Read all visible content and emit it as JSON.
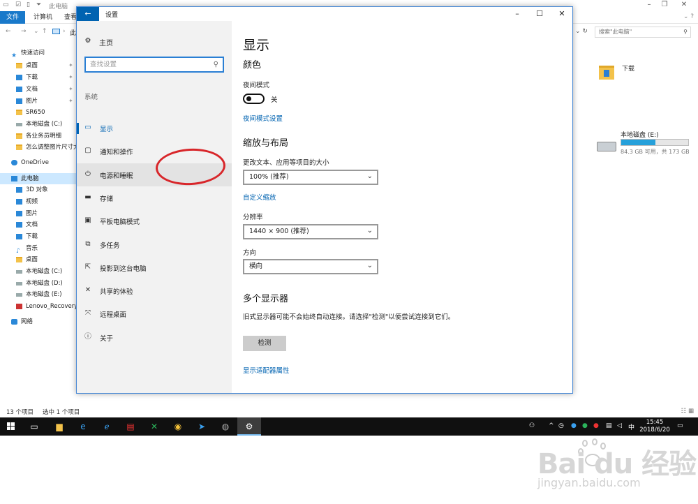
{
  "explorer": {
    "title": "此电脑",
    "tabs": [
      "文件",
      "计算机",
      "查看"
    ],
    "breadcrumb": "此",
    "search_placeholder": "搜索\"此电脑\"",
    "nav": [
      {
        "label": "快速访问",
        "icon": "star-icon",
        "pinned": false,
        "selected": false
      },
      {
        "label": "桌面",
        "icon": "folder-icon",
        "pinned": true,
        "selected": false
      },
      {
        "label": "下载",
        "icon": "download-icon",
        "pinned": true,
        "selected": false
      },
      {
        "label": "文档",
        "icon": "document-icon",
        "pinned": true,
        "selected": false
      },
      {
        "label": "图片",
        "icon": "picture-icon",
        "pinned": true,
        "selected": false
      },
      {
        "label": "SR650",
        "icon": "folder-icon",
        "pinned": false,
        "selected": false
      },
      {
        "label": "本地磁盘 (C:)",
        "icon": "drive-icon",
        "pinned": false,
        "selected": false
      },
      {
        "label": "各业务员明细",
        "icon": "folder-icon",
        "pinned": false,
        "selected": false
      },
      {
        "label": "怎么调整图片尺寸大",
        "icon": "folder-icon",
        "pinned": false,
        "selected": false
      },
      {
        "label": "OneDrive",
        "icon": "cloud-icon",
        "pinned": false,
        "selected": false
      },
      {
        "label": "此电脑",
        "icon": "computer-icon",
        "pinned": false,
        "selected": true
      },
      {
        "label": "3D 对象",
        "icon": "cube-icon",
        "pinned": false,
        "selected": false
      },
      {
        "label": "视频",
        "icon": "video-icon",
        "pinned": false,
        "selected": false
      },
      {
        "label": "图片",
        "icon": "picture-icon",
        "pinned": false,
        "selected": false
      },
      {
        "label": "文档",
        "icon": "document-icon",
        "pinned": false,
        "selected": false
      },
      {
        "label": "下载",
        "icon": "download-icon",
        "pinned": false,
        "selected": false
      },
      {
        "label": "音乐",
        "icon": "music-icon",
        "pinned": false,
        "selected": false
      },
      {
        "label": "桌面",
        "icon": "folder-icon",
        "pinned": false,
        "selected": false
      },
      {
        "label": "本地磁盘 (C:)",
        "icon": "drive-icon",
        "pinned": false,
        "selected": false
      },
      {
        "label": "本地磁盘 (D:)",
        "icon": "drive-icon",
        "pinned": false,
        "selected": false
      },
      {
        "label": "本地磁盘 (E:)",
        "icon": "drive-icon",
        "pinned": false,
        "selected": false
      },
      {
        "label": "Lenovo_Recovery",
        "icon": "recovery-drive-icon",
        "pinned": false,
        "selected": false
      },
      {
        "label": "网络",
        "icon": "network-icon",
        "pinned": false,
        "selected": false
      }
    ],
    "content": {
      "folder_label": "下载",
      "drive_name": "本地磁盘 (E:)",
      "drive_info": "84.3 GB 可用，共 173 GB",
      "drive_used_fraction": 0.51
    },
    "status": {
      "count": "13 个项目",
      "selected": "选中 1 个项目"
    }
  },
  "settings": {
    "window_title": "设置",
    "sidebar": {
      "home": "主页",
      "search_placeholder": "查找设置",
      "section": "系统",
      "items": [
        {
          "label": "显示",
          "icon": "monitor-icon",
          "active": true
        },
        {
          "label": "通知和操作",
          "icon": "notification-icon",
          "active": false
        },
        {
          "label": "电源和睡眠",
          "icon": "power-icon",
          "active": false
        },
        {
          "label": "存储",
          "icon": "storage-icon",
          "active": false
        },
        {
          "label": "平板电脑模式",
          "icon": "tablet-icon",
          "active": false
        },
        {
          "label": "多任务",
          "icon": "multitask-icon",
          "active": false
        },
        {
          "label": "投影到这台电脑",
          "icon": "project-icon",
          "active": false
        },
        {
          "label": "共享的体验",
          "icon": "share-icon",
          "active": false
        },
        {
          "label": "远程桌面",
          "icon": "remote-icon",
          "active": false
        },
        {
          "label": "关于",
          "icon": "info-icon",
          "active": false
        }
      ]
    },
    "main": {
      "title": "显示",
      "color_heading": "颜色",
      "night_mode_label": "夜间模式",
      "night_mode_state": "关",
      "night_mode_link": "夜间模式设置",
      "scale_heading": "缩放与布局",
      "scale_label": "更改文本、应用等项目的大小",
      "scale_value": "100% (推荐)",
      "custom_scale_link": "自定义缩放",
      "resolution_label": "分辨率",
      "resolution_value": "1440 × 900 (推荐)",
      "orientation_label": "方向",
      "orientation_value": "横向",
      "multi_heading": "多个显示器",
      "multi_desc": "旧式显示器可能不会始终自动连接。请选择\"检测\"以便尝试连接到它们。",
      "detect_button": "检测",
      "adapter_link": "显示适配器属性"
    }
  },
  "taskbar": {
    "time": "15:45",
    "date": "2018/6/20",
    "ime": "中"
  },
  "watermark": {
    "brand": "Bai du 经验",
    "url": "jingyan.baidu.com"
  },
  "colors": {
    "accent": "#0063b1",
    "annotation_circle": "#d8262a",
    "taskbar": "#101010"
  }
}
